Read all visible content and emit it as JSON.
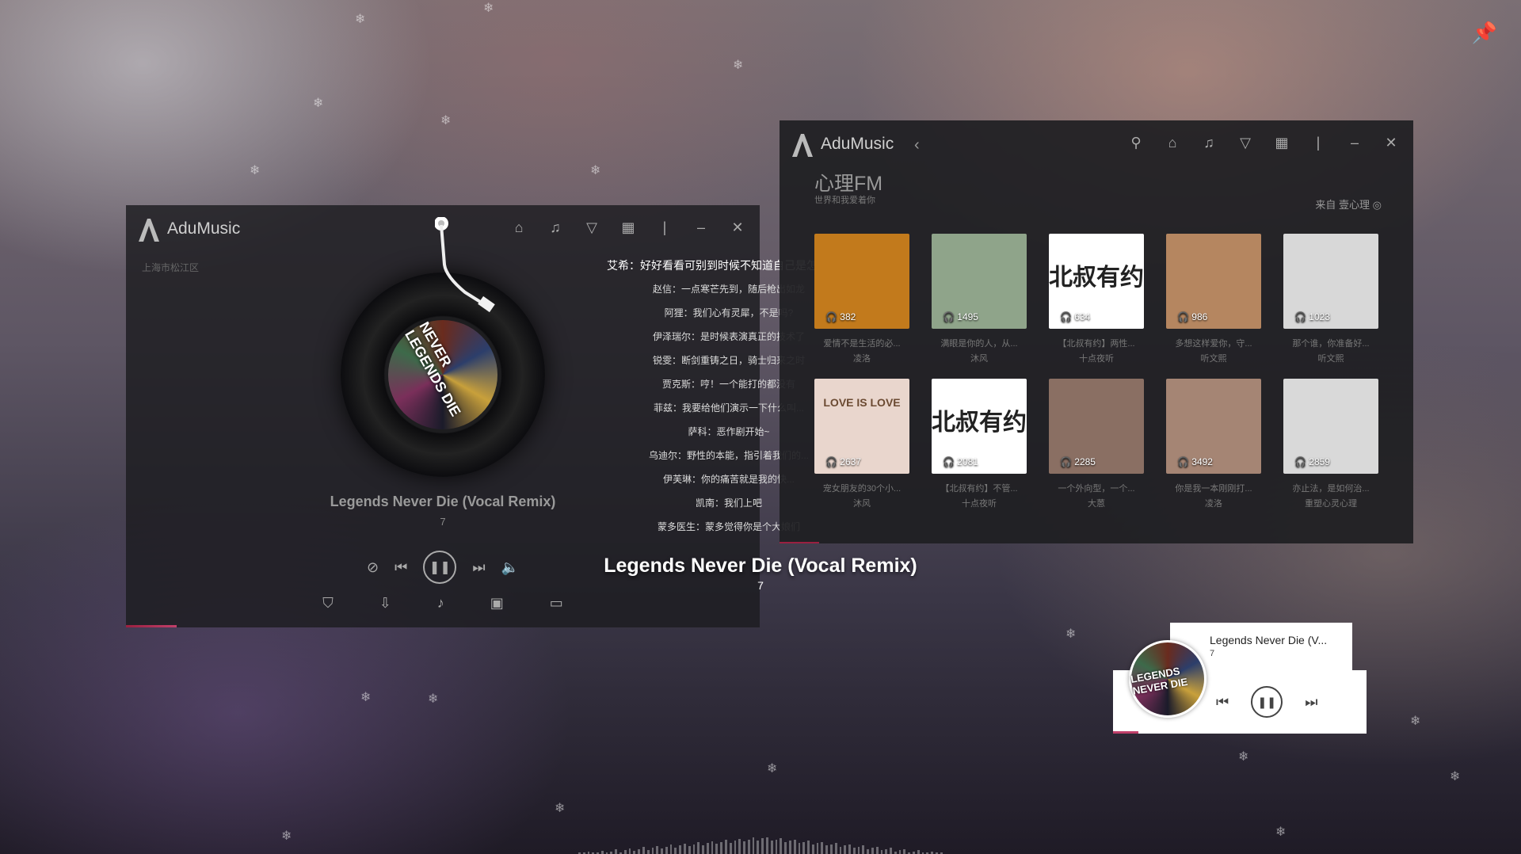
{
  "player": {
    "app_name": "AduMusic",
    "location": "上海市松江区",
    "song_title": "Legends Never Die (Vocal Remix)",
    "song_subtitle": "7",
    "album_text": "NEVER LEGENDS DIE",
    "progress": 0.08
  },
  "lyrics": [
    {
      "text": "艾希：好好看看可别到时候不知道自己是怎么死的",
      "current": true
    },
    {
      "text": "赵信：一点寒芒先到，随后枪出如龙"
    },
    {
      "text": "阿狸：我们心有灵犀，不是吗?"
    },
    {
      "text": "伊泽瑞尔：是时候表演真正的技术了"
    },
    {
      "text": "锐雯：断剑重铸之日，骑士归来之时"
    },
    {
      "text": "贾克斯：哼！一个能打的都没有"
    },
    {
      "text": "菲兹：我要给他们演示一下什么叫..."
    },
    {
      "text": "萨科：恶作剧开始~"
    },
    {
      "text": "乌迪尔：野性的本能，指引着我们的..."
    },
    {
      "text": "伊芙琳：你的痛苦就是我的快..."
    },
    {
      "text": "凯南：我们上吧"
    },
    {
      "text": "蒙多医生：蒙多觉得你是个大娘们"
    }
  ],
  "center_title": "Legends Never Die (Vocal Remix)",
  "center_subtitle": "7",
  "fm": {
    "app_name": "AduMusic",
    "heading": "心理FM",
    "subheading": "世界和我爱着你",
    "source": "来自 壹心理",
    "cards": [
      {
        "count": "382",
        "caption": "爱情不是生活的必...",
        "author": "凌洛",
        "bg": "#c27a1c"
      },
      {
        "count": "1495",
        "caption": "满眼是你的人，从...",
        "author": "沐风",
        "bg": "#8fa48a"
      },
      {
        "count": "634",
        "caption": "【北叔有约】两性...",
        "author": "十点夜听",
        "bg": "#ffffff",
        "logo": "北叔有约"
      },
      {
        "count": "986",
        "caption": "多想这样爱你，守...",
        "author": "听文熙",
        "bg": "#b58660"
      },
      {
        "count": "1023",
        "caption": "那个谁，你准备好...",
        "author": "听文熙",
        "bg": "#d8d8d8"
      },
      {
        "count": "2637",
        "caption": "宠女朋友的30个小...",
        "author": "沐风",
        "bg": "#e9d6cd",
        "logo": "LOVE IS LOVE"
      },
      {
        "count": "2081",
        "caption": "【北叔有约】不管...",
        "author": "十点夜听",
        "bg": "#ffffff",
        "logo": "北叔有约"
      },
      {
        "count": "2285",
        "caption": "一个外向型，一个...",
        "author": "大蒽",
        "bg": "#8a6f63"
      },
      {
        "count": "3492",
        "caption": "你是我一本刚刚打...",
        "author": "凌洛",
        "bg": "#a58574"
      },
      {
        "count": "2859",
        "caption": "亦止法，是如何治...",
        "author": "重塑心灵心理",
        "bg": "#d9d9d9"
      }
    ]
  },
  "mini": {
    "title": "Legends Never Die (V...",
    "subtitle": "7",
    "disc_text": "LEGENDS NEVER DIE",
    "progress": 0.1
  }
}
